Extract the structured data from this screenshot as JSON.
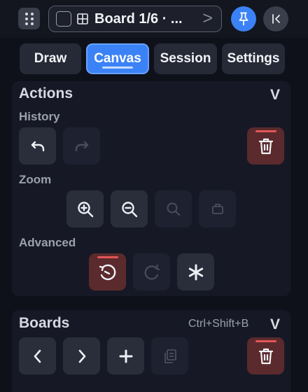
{
  "header": {
    "title": "Board 1/6 · ...",
    "chevron": ">",
    "icons": [
      "drag-grid-icon",
      "checkbox-icon",
      "grid-icon",
      "pin-icon",
      "collapse-panel-icon"
    ]
  },
  "tabs": [
    {
      "label": "Draw",
      "active": false
    },
    {
      "label": "Canvas",
      "active": true
    },
    {
      "label": "Session",
      "active": false
    },
    {
      "label": "Settings",
      "active": false
    }
  ],
  "actions": {
    "title": "Actions",
    "collapse": "V",
    "history_label": "History",
    "zoom_label": "Zoom",
    "advanced_label": "Advanced",
    "history_buttons": [
      {
        "icon": "undo-icon",
        "enabled": true
      },
      {
        "icon": "redo-icon",
        "enabled": false
      },
      {
        "icon": "trash-icon",
        "enabled": true,
        "danger": true
      }
    ],
    "zoom_buttons": [
      {
        "icon": "zoom-in-icon",
        "enabled": true
      },
      {
        "icon": "zoom-out-icon",
        "enabled": true
      },
      {
        "icon": "zoom-reset-icon",
        "enabled": false
      },
      {
        "icon": "fit-icon",
        "enabled": false
      }
    ],
    "advanced_buttons": [
      {
        "icon": "reset-rotate-icon",
        "enabled": true,
        "danger": true
      },
      {
        "icon": "rotate-icon",
        "enabled": false
      },
      {
        "icon": "asterisk-icon",
        "enabled": true
      }
    ]
  },
  "boards": {
    "title": "Boards",
    "shortcut": "Ctrl+Shift+B",
    "collapse": "V",
    "buttons": [
      {
        "icon": "prev-icon",
        "enabled": true
      },
      {
        "icon": "next-icon",
        "enabled": true
      },
      {
        "icon": "plus-icon",
        "enabled": true
      },
      {
        "icon": "duplicate-icon",
        "enabled": false
      },
      {
        "icon": "trash-icon",
        "enabled": true,
        "danger": true
      }
    ]
  },
  "colors": {
    "accent": "#3b82f6",
    "danger": "#e05757",
    "danger_bg": "#5b2a2d",
    "background": "#0f111a"
  }
}
